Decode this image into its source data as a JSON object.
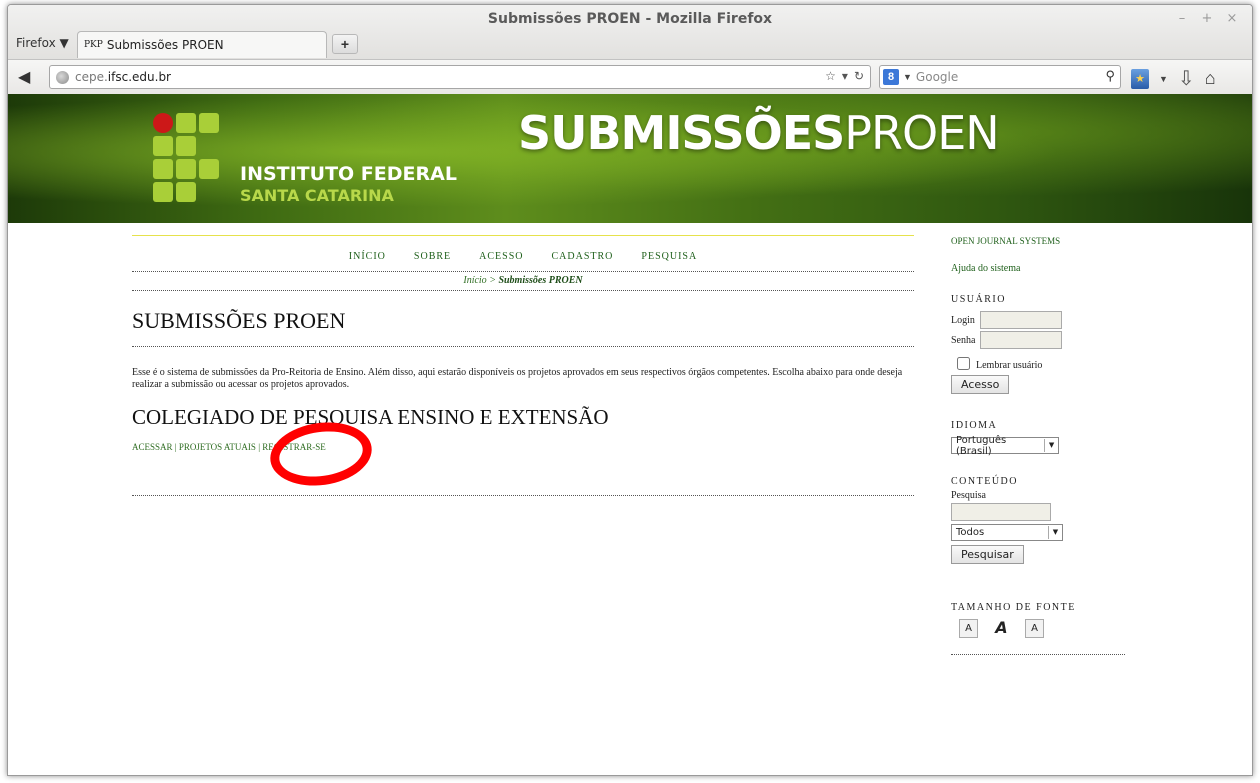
{
  "browser": {
    "window_title": "Submissões PROEN - Mozilla Firefox",
    "menu_label": "Firefox ▼",
    "tab": {
      "favicon": "PKP",
      "label": "Submissões PROEN"
    },
    "new_tab": "+",
    "url_host_dim": "cepe.",
    "url_host_main": "ifsc.edu.br",
    "search_engine_icon": "8",
    "search_placeholder": "Google",
    "controls": [
      "–",
      "+",
      "×"
    ]
  },
  "banner": {
    "inst_line1": "INSTITUTO FEDERAL",
    "inst_line2": "SANTA CATARINA",
    "title_bold": "SUBMISSÕES",
    "title_light": "PROEN"
  },
  "nav": {
    "items": [
      "INÍCIO",
      "SOBRE",
      "ACESSO",
      "CADASTRO",
      "PESQUISA"
    ]
  },
  "breadcrumb": {
    "home": "Início",
    "sep": " > ",
    "current": "Submissões PROEN"
  },
  "main": {
    "title": "SUBMISSÕES PROEN",
    "intro": "Esse é o sistema de submissões da Pro-Reitoria de Ensino. Além disso, aqui estarão disponíveis os projetos aprovados em seus respectivos órgãos competentes. Escolha abaixo para onde deseja realizar a submissão ou acessar os projetos aprovados.",
    "section_title": "COLEGIADO DE PESQUISA ENSINO E EXTENSÃO",
    "links": [
      "ACESSAR",
      "PROJETOS ATUAIS",
      "REGISTRAR-SE"
    ]
  },
  "sidebar": {
    "ojs": "OPEN JOURNAL SYSTEMS",
    "help": "Ajuda do sistema",
    "user_head": "USUÁRIO",
    "login_label": "Login",
    "password_label": "Senha",
    "remember": "Lembrar usuário",
    "login_button": "Acesso",
    "lang_head": "IDIOMA",
    "lang_selected": "Português (Brasil)",
    "content_head": "CONTEÚDO",
    "search_label": "Pesquisa",
    "scope_selected": "Todos",
    "search_button": "Pesquisar",
    "font_head": "TAMANHO DE FONTE",
    "font_buttons": [
      "A",
      "A",
      "A"
    ]
  }
}
